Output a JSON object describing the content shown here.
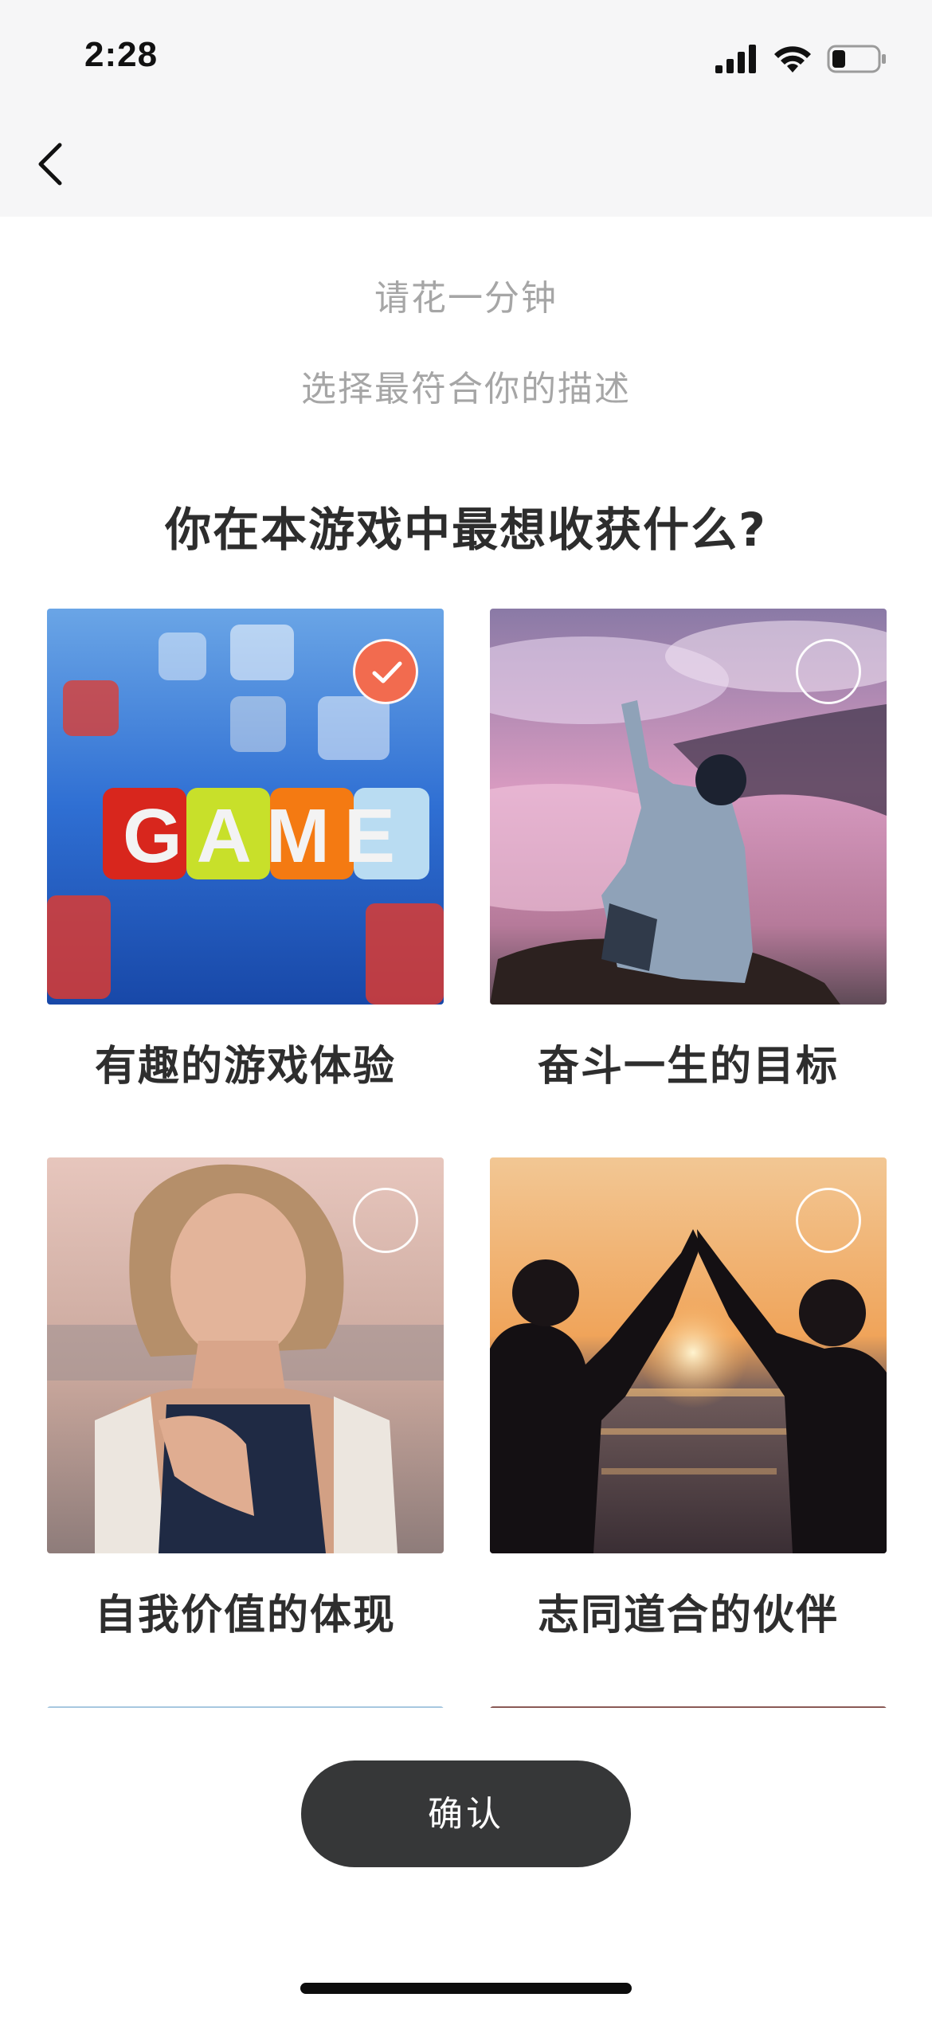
{
  "status": {
    "time": "2:28"
  },
  "header": {
    "subtitle_1": "请花一分钟",
    "subtitle_2": "选择最符合你的描述"
  },
  "question": "你在本游戏中最想收获什么?",
  "options": [
    {
      "label": "有趣的游戏体验",
      "selected": true,
      "image_letters": "GAME"
    },
    {
      "label": "奋斗一生的目标",
      "selected": false
    },
    {
      "label": "自我价值的体现",
      "selected": false
    },
    {
      "label": "志同道合的伙伴",
      "selected": false
    }
  ],
  "confirm_label": "确认",
  "colors": {
    "accent": "#f26b4f",
    "button": "#363738",
    "nav_bg": "#f6f6f7"
  }
}
